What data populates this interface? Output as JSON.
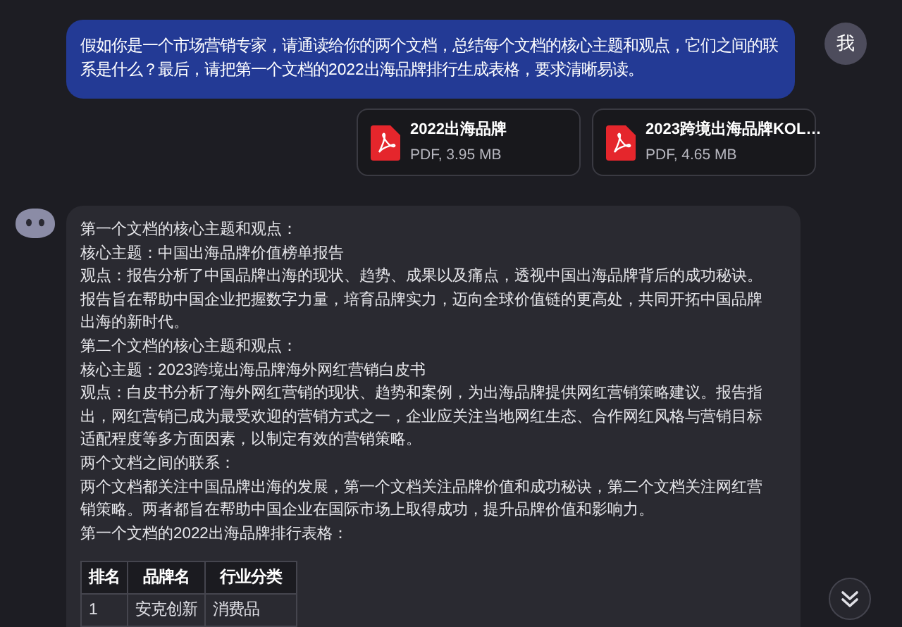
{
  "user_message": {
    "avatar": "我",
    "text": "假如你是一个市场营销专家，请通读给你的两个文档，总结每个文档的核心主题和观点，它们之间的联系是什么？最后，请把第一个文档的2022出海品牌排行生成表格，要求清晰易读。"
  },
  "attachments": [
    {
      "name": "2022出海品牌",
      "meta": "PDF, 3.95 MB"
    },
    {
      "name": "2023跨境出海品牌KOL…",
      "meta": "PDF, 4.65 MB"
    }
  ],
  "reply": {
    "paragraphs": [
      "第一个文档的核心主题和观点：",
      "核心主题：中国出海品牌价值榜单报告",
      "观点：报告分析了中国品牌出海的现状、趋势、成果以及痛点，透视中国出海品牌背后的成功秘诀。",
      "报告旨在帮助中国企业把握数字力量，培育品牌实力，迈向全球价值链的更高处，共同开拓中国品牌出海的新时代。",
      "第二个文档的核心主题和观点：",
      "核心主题：2023跨境出海品牌海外网红营销白皮书",
      "观点：白皮书分析了海外网红营销的现状、趋势和案例，为出海品牌提供网红营销策略建议。报告指出，网红营销已成为最受欢迎的营销方式之一，企业应关注当地网红生态、合作网红风格与营销目标适配程度等多方面因素，以制定有效的营销策略。",
      "两个文档之间的联系：",
      "两个文档都关注中国品牌出海的发展，第一个文档关注品牌价值和成功秘诀，第二个文档关注网红营销策略。两者都旨在帮助中国企业在国际市场上取得成功，提升品牌价值和影响力。",
      "第一个文档的2022出海品牌排行表格："
    ],
    "table": {
      "columns": [
        "排名",
        "品牌名",
        "行业分类"
      ],
      "rows": [
        [
          "1",
          "安克创新",
          "消费品"
        ]
      ]
    }
  }
}
